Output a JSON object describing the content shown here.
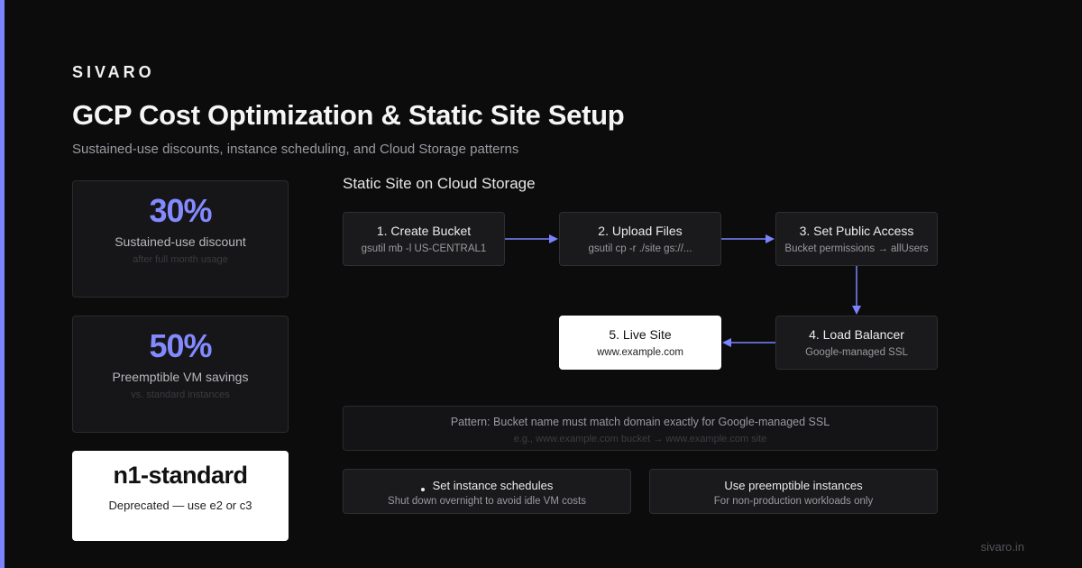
{
  "brand": "SIVARO",
  "title": "GCP Cost Optimization & Static Site Setup",
  "subtitle": "Sustained-use discounts, instance scheduling, and Cloud Storage patterns",
  "stats": [
    {
      "value": "30%",
      "label": "Sustained-use discount",
      "sub": "after full month usage"
    },
    {
      "value": "50%",
      "label": "Preemptible VM savings",
      "sub": "vs. standard instances"
    }
  ],
  "deprecated": {
    "title": "n1-standard",
    "sub": "Deprecated — use e2 or c3"
  },
  "section_title": "Static Site on Cloud Storage",
  "steps": [
    {
      "title": "1. Create Bucket",
      "sub": "gsutil mb -l US-CENTRAL1"
    },
    {
      "title": "2. Upload Files",
      "sub": "gsutil cp -r ./site gs://..."
    },
    {
      "title": "3. Set Public Access",
      "sub": "Bucket permissions → allUsers"
    },
    {
      "title": "4. Load Balancer",
      "sub": "Google-managed SSL"
    },
    {
      "title": "5. Live Site",
      "sub": "www.example.com"
    }
  ],
  "pattern": {
    "main": "Pattern: Bucket name must match domain exactly for Google-managed SSL",
    "sub": "e.g., www.example.com bucket → www.example.com site"
  },
  "tips": [
    {
      "title": "Set instance schedules",
      "sub": "Shut down overnight to avoid idle VM costs"
    },
    {
      "title": "Use preemptible instances",
      "sub": "For non-production workloads only"
    }
  ],
  "footer": "sivaro.in",
  "colors": {
    "accent": "#7b83ff",
    "background": "#0c0c0d",
    "card": "#1a1a1c"
  }
}
